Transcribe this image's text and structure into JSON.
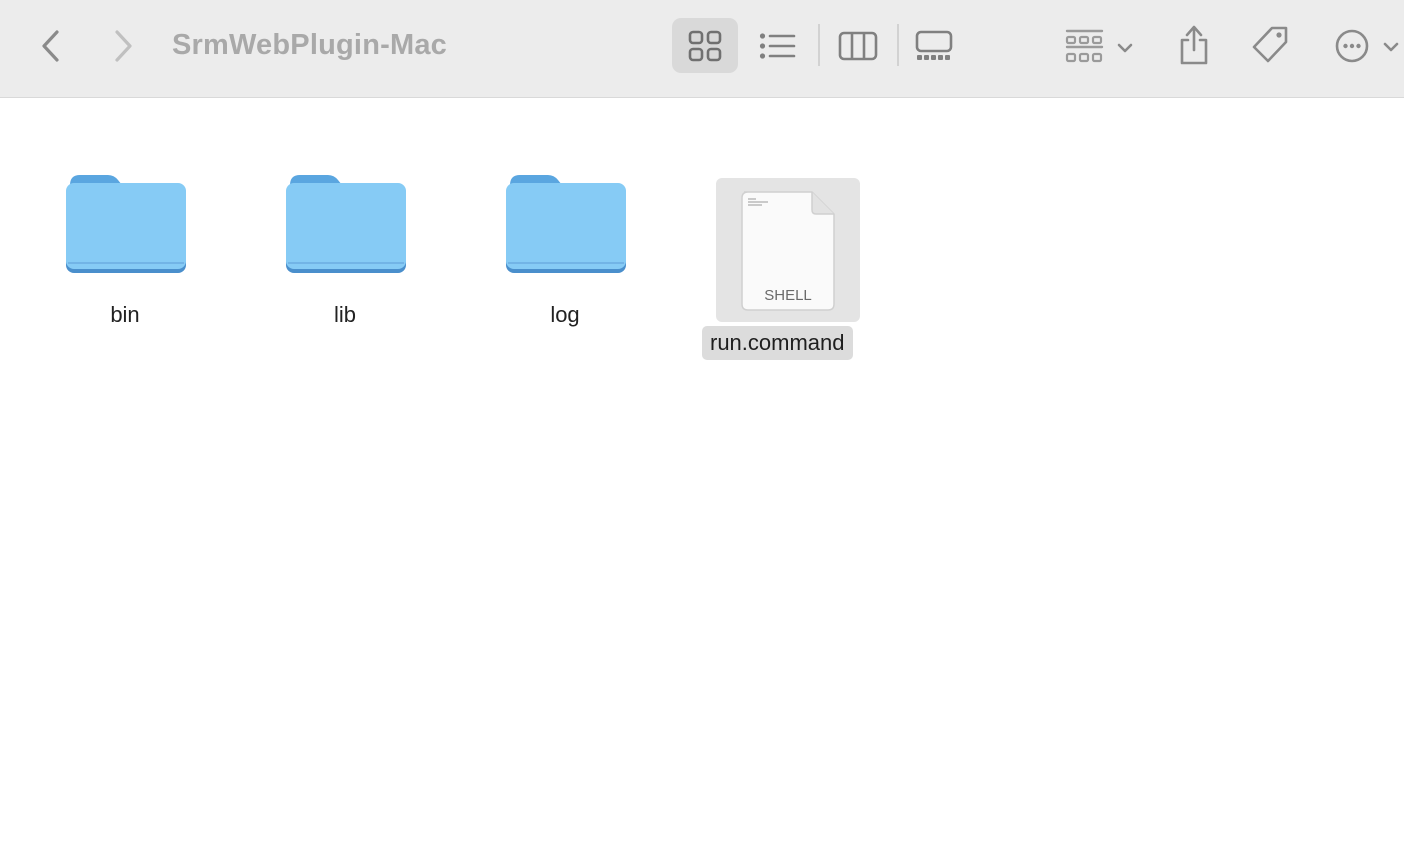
{
  "window": {
    "title": "SrmWebPlugin-Mac"
  },
  "toolbar": {
    "back_icon": "chevron-left-icon",
    "forward_icon": "chevron-right-icon",
    "views": [
      {
        "name": "icon-view",
        "icon": "grid-icon",
        "selected": true
      },
      {
        "name": "list-view",
        "icon": "list-icon",
        "selected": false
      },
      {
        "name": "column-view",
        "icon": "columns-icon",
        "selected": false
      },
      {
        "name": "gallery-view",
        "icon": "gallery-icon",
        "selected": false
      }
    ],
    "group_icon": "group-grid-icon",
    "share_icon": "share-icon",
    "tag_icon": "tag-icon",
    "more_icon": "ellipsis-circle-icon"
  },
  "colors": {
    "folder_front": "#86cbf5",
    "folder_back": "#5aa6e0",
    "toolbar_bg": "#ececec",
    "selection_bg": "#dcdcdc"
  },
  "items": [
    {
      "name": "bin",
      "kind": "folder",
      "icon": "folder-icon"
    },
    {
      "name": "lib",
      "kind": "folder",
      "icon": "folder-icon"
    },
    {
      "name": "log",
      "kind": "folder",
      "icon": "folder-icon"
    },
    {
      "name": "run.command",
      "kind": "shell-script",
      "icon": "shell-document-icon",
      "badge": "SHELL",
      "selected": true
    }
  ]
}
